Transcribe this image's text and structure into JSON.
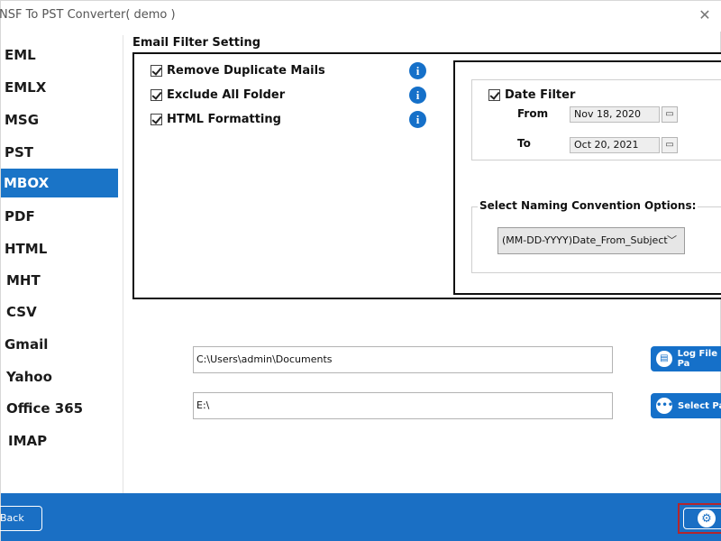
{
  "window": {
    "title": "NSF To PST Converter( demo )",
    "close_glyph": "✕"
  },
  "sidebar": {
    "items": [
      {
        "label": "EML"
      },
      {
        "label": "EMLX"
      },
      {
        "label": "MSG"
      },
      {
        "label": "PST"
      },
      {
        "label": "MBOX"
      },
      {
        "label": "PDF"
      },
      {
        "label": "HTML"
      },
      {
        "label": "MHT"
      },
      {
        "label": "CSV"
      },
      {
        "label": "Gmail"
      },
      {
        "label": "Yahoo"
      },
      {
        "label": "Office 365"
      },
      {
        "label": "IMAP"
      }
    ],
    "active": "MBOX"
  },
  "email_filter": {
    "section_title": "Email Filter Setting",
    "options": [
      {
        "label": "Remove Duplicate Mails",
        "checked": true
      },
      {
        "label": "Exclude All Folder",
        "checked": true
      },
      {
        "label": "HTML Formatting",
        "checked": true
      }
    ],
    "info_glyph": "i"
  },
  "date_filter": {
    "label": "Date Filter",
    "checked": true,
    "from_label": "From",
    "from_value": "Nov 18, 2020",
    "to_label": "To",
    "to_value": "Oct 20, 2021"
  },
  "naming": {
    "title": "Select Naming Convention Options:",
    "selected": "(MM-DD-YYYY)Date_From_Subject"
  },
  "paths": {
    "log_path": "C:\\Users\\admin\\Documents",
    "log_button": "Log File Pa",
    "dest_path": "E:\\",
    "dest_button": "Select Pa"
  },
  "footer": {
    "back_label": "Back"
  },
  "colors": {
    "accent": "#1a74c7",
    "highlight_border": "#b3262d"
  }
}
